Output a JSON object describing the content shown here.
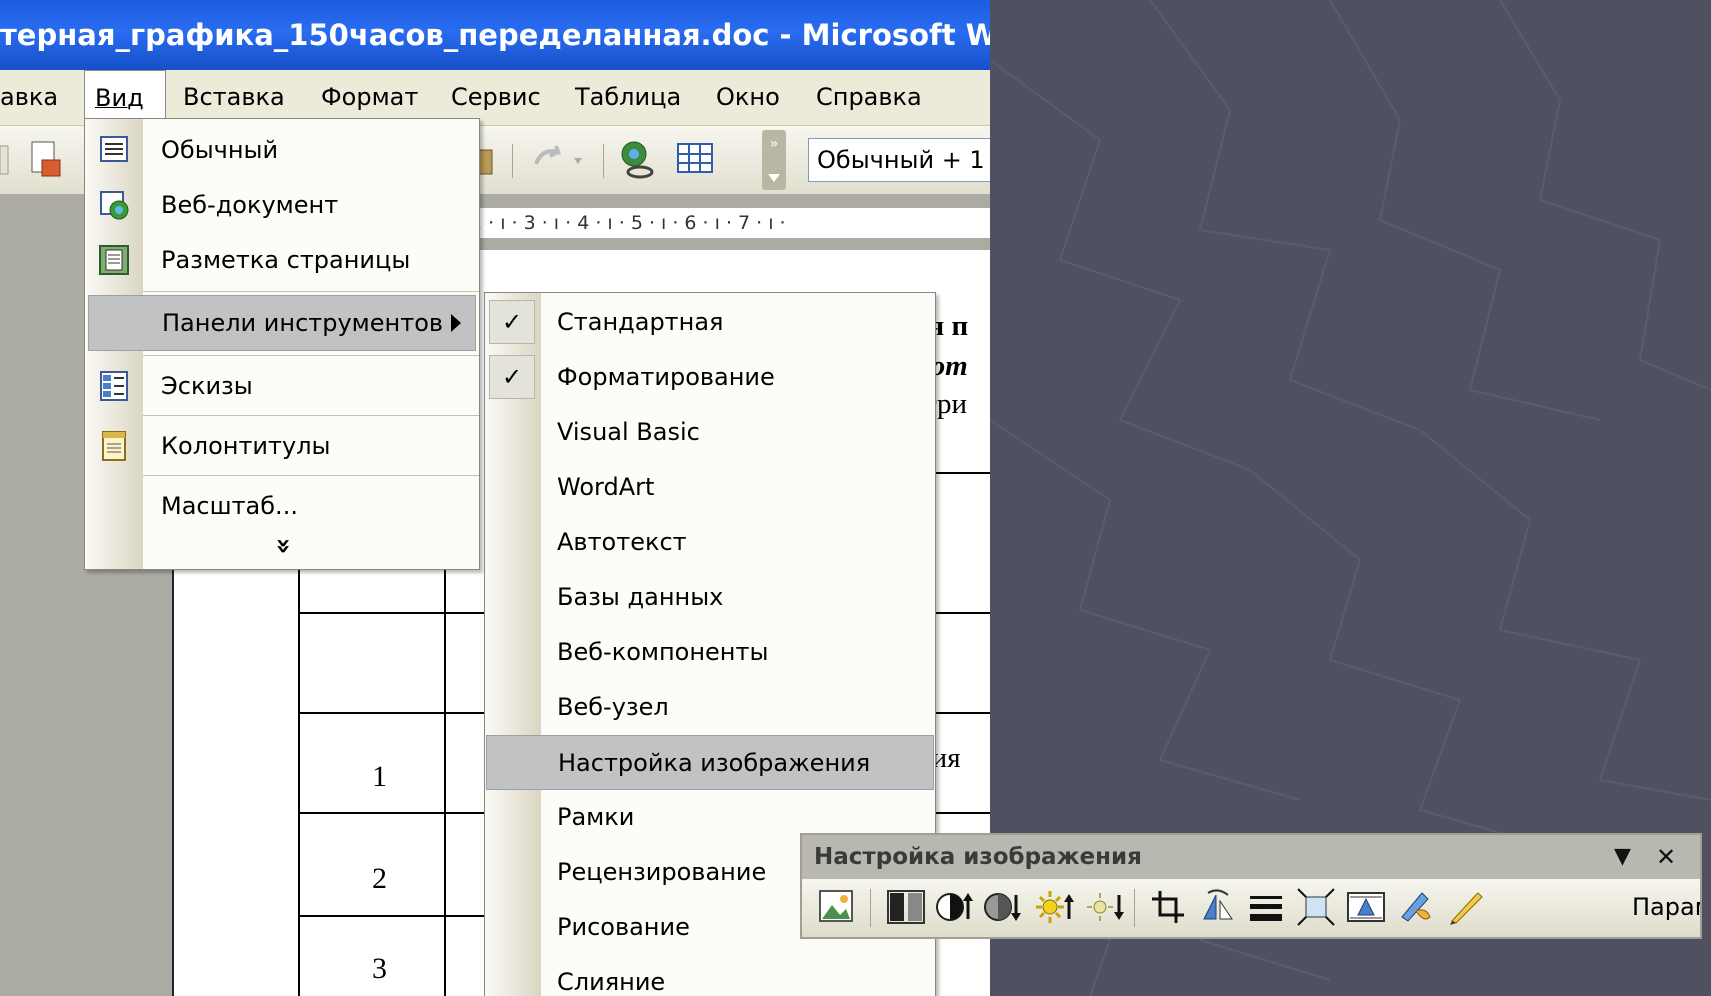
{
  "window": {
    "title": "терная_графика_150часов_переделанная.doc - Microsoft Word"
  },
  "menubar": {
    "items": [
      "авка",
      "Вид",
      "Вставка",
      "Формат",
      "Сервис",
      "Таблица",
      "Окно",
      "Справка"
    ]
  },
  "toolbar": {
    "style_box": "Обычный + 1"
  },
  "ruler": {
    "text": "2 · ı · 3 · ı · 4 · ı · 5 · ı · 6 · ı · 7 · ı ·"
  },
  "document": {
    "fragments": [
      "ая п",
      "ют",
      "три",
      "тия"
    ],
    "row_numbers": [
      "1",
      "2",
      "3"
    ]
  },
  "view_menu": {
    "items": [
      {
        "label": "Обычный",
        "icon": "normal-view-icon"
      },
      {
        "label": "Веб-документ",
        "icon": "web-layout-icon"
      },
      {
        "label": "Разметка страницы",
        "icon": "print-layout-icon"
      },
      {
        "label": "Панели инструментов",
        "icon": ""
      },
      {
        "label": "Эскизы",
        "icon": "thumbnails-icon"
      },
      {
        "label": "Колонтитулы",
        "icon": "header-footer-icon"
      },
      {
        "label": "Масштаб...",
        "icon": ""
      }
    ],
    "expand_glyph": "»"
  },
  "toolbars_submenu": {
    "items": [
      {
        "label": "Стандартная",
        "checked": true
      },
      {
        "label": "Форматирование",
        "checked": true
      },
      {
        "label": "Visual Basic",
        "checked": false
      },
      {
        "label": "WordArt",
        "checked": false
      },
      {
        "label": "Автотекст",
        "checked": false
      },
      {
        "label": "Базы данных",
        "checked": false
      },
      {
        "label": "Веб-компоненты",
        "checked": false
      },
      {
        "label": "Веб-узел",
        "checked": false
      },
      {
        "label": "Настройка изображения",
        "checked": false
      },
      {
        "label": "Рамки",
        "checked": false
      },
      {
        "label": "Рецензирование",
        "checked": false
      },
      {
        "label": "Рисование",
        "checked": false
      },
      {
        "label": "Слияние",
        "checked": false
      }
    ],
    "check_glyph": "✓"
  },
  "picture_toolbar": {
    "title": "Настройка изображения",
    "dropdown_glyph": "▼",
    "close_glyph": "✕",
    "overflow_label": "Парам",
    "tools": [
      "insert-picture-icon",
      "color-icon",
      "more-contrast-icon",
      "less-contrast-icon",
      "more-brightness-icon",
      "less-brightness-icon",
      "crop-icon",
      "rotate-icon",
      "line-style-icon",
      "compress-pictures-icon",
      "text-wrapping-icon",
      "format-picture-icon",
      "set-transparent-color-icon"
    ]
  }
}
